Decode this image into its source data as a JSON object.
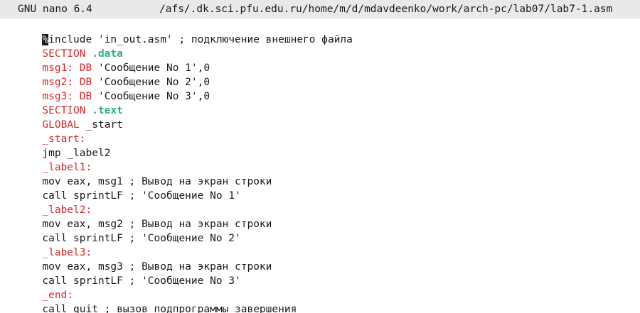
{
  "titlebar": {
    "app": "GNU nano 6.4",
    "path": "/afs/.dk.sci.pfu.edu.ru/home/m/d/mdavdeenko/work/arch-pc/lab07/lab7-1.asm"
  },
  "colors": {
    "keyword_red": "#cf2a2a",
    "section_green": "#27b27e",
    "text": "#1a1a1a",
    "titlebar_bg": "#e9e9e9"
  },
  "editor": {
    "lines": [
      {
        "cursor": "%",
        "rest": "include 'in_out.asm' ; подключение внешнего файла"
      },
      {
        "red": "SECTION ",
        "green": ".data"
      },
      {
        "red": "msg1: DB ",
        "plain": "'Сообщение No 1',0"
      },
      {
        "red": "msg2: DB ",
        "plain": "'Сообщение No 2',0"
      },
      {
        "red": "msg3: DB ",
        "plain": "'Сообщение No 3',0"
      },
      {
        "red": "SECTION ",
        "green": ".text"
      },
      {
        "red": "GLOBAL ",
        "plain": "_start"
      },
      {
        "red": "_start:"
      },
      {
        "plain": "jmp _label2"
      },
      {
        "red": "_label1:"
      },
      {
        "plain": "mov eax, msg1 ; Вывод на экран строки"
      },
      {
        "plain": "call sprintLF ; 'Сообщение No 1'"
      },
      {
        "red": "_label2:"
      },
      {
        "plain": "mov eax, msg2 ; Вывод на экран строки"
      },
      {
        "plain": "call sprintLF ; 'Сообщение No 2'"
      },
      {
        "red": "_label3:"
      },
      {
        "plain": "mov eax, msg3 ; Вывод на экран строки"
      },
      {
        "plain": "call sprintLF ; 'Сообщение No 3'"
      },
      {
        "red": "_end:"
      },
      {
        "plain": "call quit ; вызов подпрограммы завершения"
      }
    ]
  }
}
